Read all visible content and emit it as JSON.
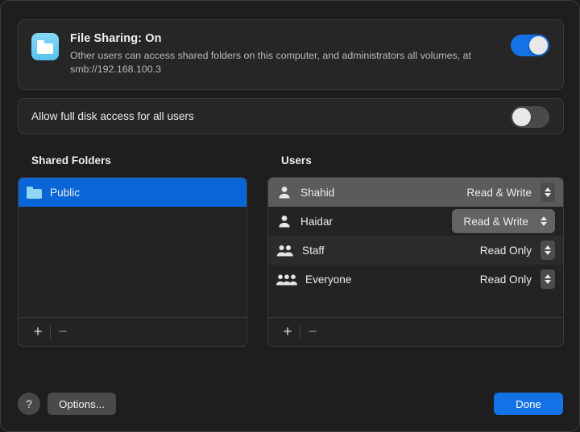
{
  "banner": {
    "icon": "file-sharing-app-icon",
    "title": "File Sharing: On",
    "description": "Other users can access shared folders on this computer, and administrators all volumes, at smb://192.168.100.3",
    "toggle_state": "on"
  },
  "full_disk_access": {
    "label": "Allow full disk access for all users",
    "toggle_state": "off"
  },
  "shared_folders": {
    "header": "Shared Folders",
    "items": [
      {
        "name": "Public",
        "icon": "folder-icon",
        "selected": true
      }
    ],
    "footer": {
      "add_label": "+",
      "remove_label": "−"
    }
  },
  "users": {
    "header": "Users",
    "items": [
      {
        "name": "Shahid",
        "icon": "person-icon",
        "permission": "Read & Write",
        "row_state": "selected"
      },
      {
        "name": "Haidar",
        "icon": "person-icon",
        "permission": "Read & Write",
        "row_state": "popup-open"
      },
      {
        "name": "Staff",
        "icon": "two-persons-icon",
        "permission": "Read Only",
        "row_state": "normal"
      },
      {
        "name": "Everyone",
        "icon": "three-persons-icon",
        "permission": "Read Only",
        "row_state": "normal"
      }
    ],
    "footer": {
      "add_label": "+",
      "remove_label": "−"
    }
  },
  "footer": {
    "help_label": "?",
    "options_label": "Options...",
    "done_label": "Done"
  },
  "colors": {
    "accent_blue": "#1373e6",
    "selection_blue": "#0a66d6",
    "window_bg": "#1e1e1e",
    "card_bg": "#262627",
    "list_bg": "#232324"
  }
}
